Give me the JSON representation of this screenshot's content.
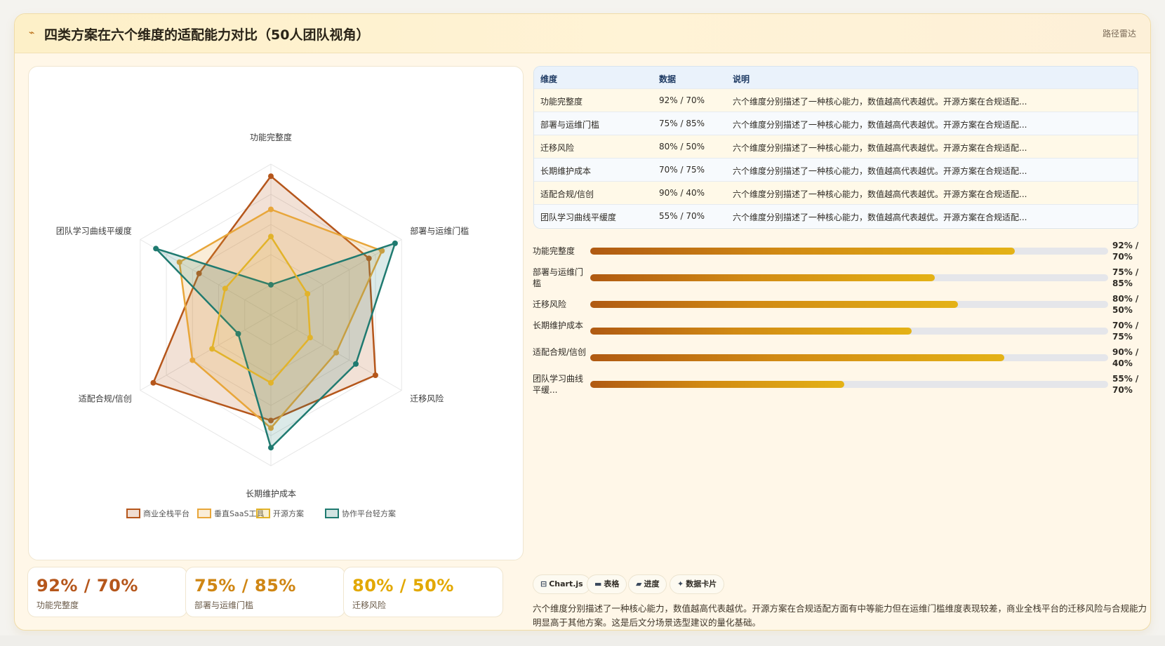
{
  "header": {
    "icon": "chart-line-icon",
    "title": "四类方案在六个维度的适配能力对比（50人团队视角）",
    "link": "路径雷达"
  },
  "colors": {
    "series": [
      "#b5561b",
      "#e8a63a",
      "#e2b32a",
      "#1f7a70"
    ],
    "accent": "#b86a10"
  },
  "chart_data": {
    "type": "radar",
    "axes": [
      "功能完整度",
      "部署与运维门槛",
      "迁移风险",
      "长期维护成本",
      "适配合规/信创",
      "团队学习曲线平缓度"
    ],
    "range": [
      0,
      100
    ],
    "grid": true,
    "legend_position": "bottom",
    "series": [
      {
        "name": "商业全栈平台",
        "values": [
          92,
          75,
          80,
          70,
          90,
          55
        ]
      },
      {
        "name": "垂直SaaS工具",
        "values": [
          70,
          85,
          50,
          75,
          60,
          70
        ]
      },
      {
        "name": "开源方案",
        "values": [
          52,
          28,
          30,
          45,
          45,
          35
        ]
      },
      {
        "name": "协作平台轻方案",
        "values": [
          20,
          95,
          65,
          88,
          25,
          88
        ]
      }
    ]
  },
  "table": {
    "headers": [
      "维度",
      "数据",
      "说明"
    ],
    "rows": [
      [
        "功能完整度",
        "92% / 70%",
        "六个维度分别描述了一种核心能力，数值越高代表越优。开源方案在合规适配..."
      ],
      [
        "部署与运维门槛",
        "75% / 85%",
        "六个维度分别描述了一种核心能力，数值越高代表越优。开源方案在合规适配..."
      ],
      [
        "迁移风险",
        "80% / 50%",
        "六个维度分别描述了一种核心能力，数值越高代表越优。开源方案在合规适配..."
      ],
      [
        "长期维护成本",
        "70% / 75%",
        "六个维度分别描述了一种核心能力，数值越高代表越优。开源方案在合规适配..."
      ],
      [
        "适配合规/信创",
        "90% / 40%",
        "六个维度分别描述了一种核心能力，数值越高代表越优。开源方案在合规适配..."
      ],
      [
        "团队学习曲线平缓度",
        "55% / 70%",
        "六个维度分别描述了一种核心能力，数值越高代表越优。开源方案在合规适配..."
      ]
    ]
  },
  "progress": [
    {
      "label": "功能完整度",
      "value": "92% / 70%",
      "fill": 0.82
    },
    {
      "label": "部署与运维门槛",
      "value": "75% / 85%",
      "fill": 0.665
    },
    {
      "label": "迁移风险",
      "value": "80% / 50%",
      "fill": 0.71
    },
    {
      "label": "长期维护成本",
      "value": "70% / 75%",
      "fill": 0.62
    },
    {
      "label": "适配合规/信创",
      "value": "90% / 40%",
      "fill": 0.8
    },
    {
      "label": "团队学习曲线平缓度",
      "display_label": "团队学习曲线平缓...",
      "value": "55% / 70%",
      "fill": 0.49
    }
  ],
  "stats": [
    {
      "value": "92% / 70%",
      "label": "功能完整度",
      "color": "#b5561b"
    },
    {
      "value": "75% / 85%",
      "label": "部署与运维门槛",
      "color": "#cf8614"
    },
    {
      "value": "80% / 50%",
      "label": "迁移风险",
      "color": "#e2a800"
    }
  ],
  "chips": [
    {
      "icon": "⊟",
      "icon_name": "chart-icon",
      "label": "Chart.js"
    },
    {
      "icon": "▬",
      "icon_name": "table-icon",
      "label": "表格"
    },
    {
      "icon": "▰",
      "icon_name": "progress-icon",
      "label": "进度"
    },
    {
      "icon": "✦",
      "icon_name": "card-icon",
      "label": "数据卡片"
    }
  ],
  "description": "六个维度分别描述了一种核心能力，数值越高代表越优。开源方案在合规适配方面有中等能力但在运维门槛维度表现较差，商业全栈平台的迁移风险与合规能力明显高于其他方案。这是后文分场景选型建议的量化基础。"
}
